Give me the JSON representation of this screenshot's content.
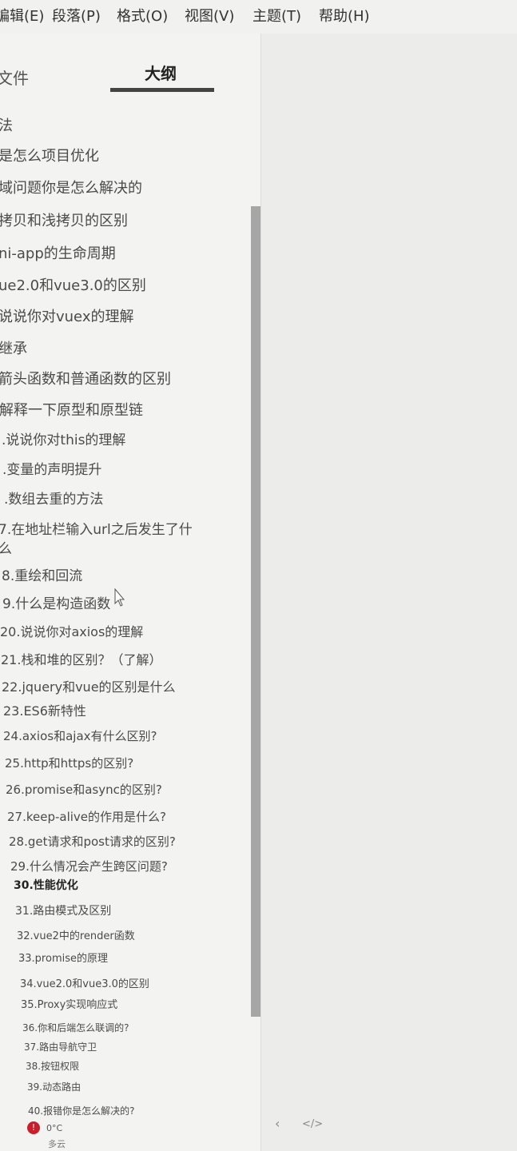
{
  "menu": [
    {
      "key": "edit",
      "label": "编辑(E)"
    },
    {
      "key": "paragraph",
      "label": "段落(P)"
    },
    {
      "key": "format",
      "label": "格式(O)"
    },
    {
      "key": "view",
      "label": "视图(V)"
    },
    {
      "key": "theme",
      "label": "主题(T)"
    },
    {
      "key": "help",
      "label": "帮助(H)"
    }
  ],
  "sidebar": {
    "tabs": {
      "files": "文件",
      "outline": "大纲"
    },
    "active_tab": "outline",
    "outline": [
      "法",
      "是怎么项目优化",
      "域问题你是怎么解决的",
      "拷贝和浅拷贝的区别",
      "ni-app的生命周期",
      "ue2.0和vue3.0的区别",
      "说说你对vuex的理解",
      "继承",
      "箭头函数和普通函数的区别",
      "解释一下原型和原型链",
      ".说说你对this的理解",
      ".变量的声明提升",
      ".数组去重的方法",
      "7.在地址栏输入url之后发生了什",
      "8.重绘和回流",
      "9.什么是构造函数",
      "20.说说你对axios的理解",
      "21.栈和堆的区别？（了解）",
      "22.jquery和vue的区别是什么",
      "23.ES6新特性",
      "24.axios和ajax有什么区别?",
      "25.http和https的区别?",
      "26.promise和async的区别?",
      "27.keep-alive的作用是什么?",
      "28.get请求和post请求的区别?",
      "29.什么情况会产生跨区问题?",
      "30.性能优化",
      "31.路由模式及区别",
      "32.vue2中的render函数",
      "33.promise的原理",
      "34.vue2.0和vue3.0的区别",
      "35.Proxy实现响应式",
      "36.你和后端怎么联调的?",
      "37.路由导航守卫",
      "38.按钮权限",
      "39.动态路由",
      "40.报错你是怎么解决的?"
    ],
    "outline_wrap": "么",
    "active_index": 26
  },
  "statusbar": {
    "temperature": "0°C",
    "weather": "多云",
    "nav_left": "‹",
    "code_toggle": "</>"
  }
}
